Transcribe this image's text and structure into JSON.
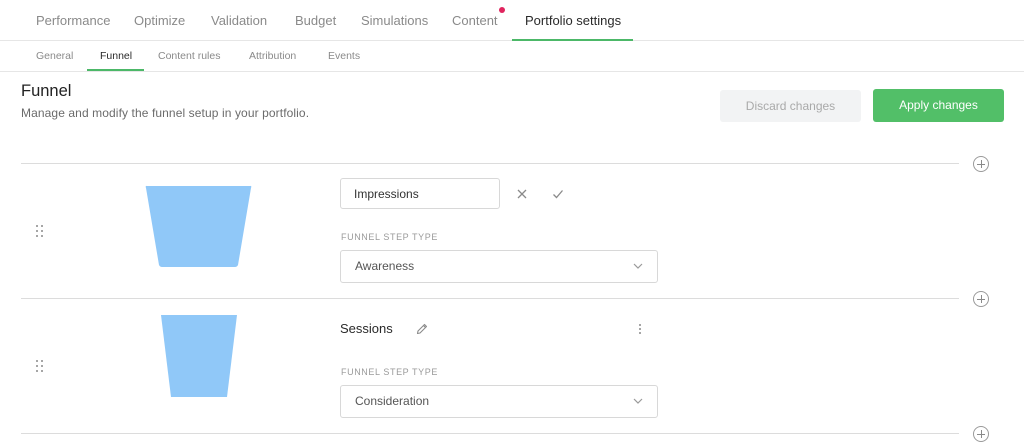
{
  "top_tabs": [
    {
      "label": "Performance"
    },
    {
      "label": "Optimize"
    },
    {
      "label": "Validation"
    },
    {
      "label": "Budget"
    },
    {
      "label": "Simulations"
    },
    {
      "label": "Content"
    },
    {
      "label": "Portfolio settings"
    }
  ],
  "active_top_tab": "Portfolio settings",
  "sub_tabs": [
    {
      "label": "General"
    },
    {
      "label": "Funnel"
    },
    {
      "label": "Content rules"
    },
    {
      "label": "Attribution"
    },
    {
      "label": "Events"
    }
  ],
  "active_sub_tab": "Funnel",
  "header": {
    "title": "Funnel",
    "subtitle": "Manage and modify the funnel setup in your portfolio."
  },
  "actions": {
    "discard_label": "Discard changes",
    "apply_label": "Apply changes"
  },
  "funnel_steps": [
    {
      "name": "Impressions",
      "editing": true,
      "type_label": "FUNNEL STEP TYPE",
      "type_value": "Awareness"
    },
    {
      "name": "Sessions",
      "editing": false,
      "type_label": "FUNNEL STEP TYPE",
      "type_value": "Consideration"
    }
  ],
  "colors": {
    "accent": "#52bf68",
    "funnel_fill": "#90c8f8",
    "notification": "#e0245e"
  },
  "icons": [
    "drag-handle-icon",
    "close-icon",
    "check-icon",
    "pencil-icon",
    "more-vertical-icon",
    "chevron-down-icon",
    "add-circle-icon"
  ]
}
